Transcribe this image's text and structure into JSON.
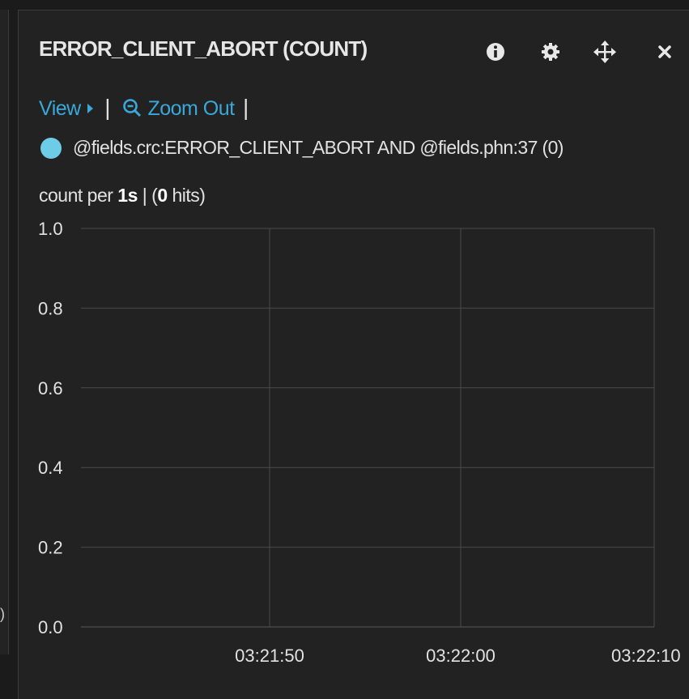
{
  "panel": {
    "title": "ERROR_CLIENT_ABORT (COUNT)",
    "icons": [
      "info-icon",
      "gear-icon",
      "move-icon",
      "close-icon"
    ]
  },
  "toolbar": {
    "view_label": "View",
    "zoom_out_label": "Zoom Out",
    "separator": "|"
  },
  "legend": {
    "dot_color": "#6ecde6",
    "query_label": "@fields.crc:ERROR_CLIENT_ABORT AND @fields.phn:37 (0)"
  },
  "summary": {
    "prefix": "count per ",
    "interval": "1s",
    "mid": " | (",
    "hits": "0",
    "suffix": " hits)"
  },
  "left_glyph": ")",
  "chart_data": {
    "type": "line",
    "title": "",
    "xlabel": "",
    "ylabel": "",
    "ylim": [
      0,
      1
    ],
    "y_ticks": [
      "0.0",
      "0.2",
      "0.4",
      "0.6",
      "0.8",
      "1.0"
    ],
    "x_ticks": [
      "03:21:50",
      "03:22:00",
      "03:22:10"
    ],
    "grid": true,
    "series": []
  }
}
